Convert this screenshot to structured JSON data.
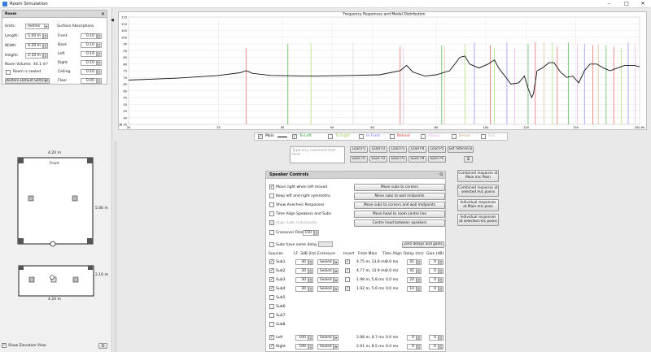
{
  "window": {
    "title": "Room Simulation"
  },
  "room": {
    "header": "Room",
    "units_label": "Units:",
    "units_value": "metres",
    "length_label": "Length:",
    "length_value": "5.00 m",
    "width_label": "Width:",
    "width_value": "4.20 m",
    "height_label": "Height:",
    "height_value": "2.10 m",
    "volume_label": "Room Volume:",
    "volume_value": "44.1 m³",
    "sealed_label": "Room is sealed",
    "restore_label": "Restore Default Settings",
    "surface_header": "Surface Absorptions",
    "surfaces": [
      {
        "label": "Front",
        "value": "0.10"
      },
      {
        "label": "Back",
        "value": "0.10"
      },
      {
        "label": "Left",
        "value": "0.10"
      },
      {
        "label": "Right",
        "value": "0.10"
      },
      {
        "label": "Ceiling",
        "value": "0.10"
      },
      {
        "label": "Floor",
        "value": "0.05"
      }
    ]
  },
  "plan": {
    "top_width": "4.20 m",
    "front_label": "Front",
    "side_length": "5.00 m",
    "elev_width": "4.20 m",
    "elev_height": "2.10 m",
    "show_elevation_label": "Show Elevation View"
  },
  "graph": {
    "title": "Frequency Responses and Modal Distribution",
    "y_ticks": [
      "115",
      "110",
      "105",
      "100",
      "95",
      "90",
      "85",
      "80",
      "75",
      "70",
      "65",
      "60",
      "55",
      "50",
      "45",
      "40",
      "35"
    ],
    "y_bottom": "dB 35",
    "x_ticks": [
      "20",
      "30",
      "40",
      "50",
      "60",
      "80",
      "100",
      "120",
      "150",
      "200 Hz"
    ]
  },
  "legend": {
    "items": [
      {
        "label": "Main",
        "checked": true,
        "color": "#000000"
      },
      {
        "label": "To Left",
        "checked": true,
        "color": "#1a9a1a"
      },
      {
        "label": "To Right",
        "checked": false,
        "color": "#8fd04a"
      },
      {
        "label": "In Front",
        "checked": false,
        "color": "#6a6aff"
      },
      {
        "label": "Behind",
        "checked": false,
        "color": "#e03030"
      },
      {
        "label": "Above",
        "checked": false,
        "color": "#e8a0e8"
      },
      {
        "label": "Below",
        "checked": false,
        "color": "#d0a878"
      },
      {
        "label": "Run",
        "checked": false,
        "color": "#c0c0c0"
      }
    ]
  },
  "comment": {
    "placeholder": "Type any comment text here",
    "load": [
      "Load P1",
      "Load P2",
      "Load P3",
      "Load P4",
      "Load P5"
    ],
    "save": [
      "Save P1",
      "Save P2",
      "Save P3",
      "Save P4",
      "Save P5"
    ],
    "set_reference": "Set reference"
  },
  "speaker": {
    "header": "Speaker Controls",
    "options": [
      {
        "label": "Move right when left moved",
        "checked": true
      },
      {
        "label": "Keep left and right symmetric",
        "checked": false
      },
      {
        "label": "Show Anechoic Responses",
        "checked": false
      },
      {
        "label": "Time Align Speakers and Subs",
        "checked": false
      },
      {
        "label": "Align Subs Individually",
        "checked": false
      }
    ],
    "crossover_label": "Crossover Filter (Hz)",
    "crossover_value": "150",
    "same_delay_label": "Subs have same delay",
    "zero_label": "Zero delays and gains",
    "actions": [
      "Move subs to corners",
      "Move subs to wall midpoints",
      "Move subs to corners and wall midpoints",
      "Move head to room centre line",
      "Centre head between speakers"
    ],
    "columns": [
      "Sources",
      "LF -3dB (Hz)",
      "Enclosure",
      "Invert",
      "From Main",
      "Time Align",
      "Delay (ms)",
      "Gain (dB)"
    ],
    "rows": [
      {
        "name": "Sub1",
        "checked": true,
        "lf": "30",
        "enc": "Sealed",
        "invert": true,
        "from": "4.75 m, 13.8 ms",
        "ta": "0.0 ms",
        "delay": "41",
        "gain": "0"
      },
      {
        "name": "Sub2",
        "checked": true,
        "lf": "30",
        "enc": "Sealed",
        "invert": true,
        "from": "4.77 m, 13.9 ms",
        "ta": "0.0 ms",
        "delay": "41",
        "gain": "0"
      },
      {
        "name": "Sub3",
        "checked": true,
        "lf": "30",
        "enc": "Sealed",
        "invert": false,
        "from": "1.98 m, 5.8 ms",
        "ta": "0.0 ms",
        "delay": "24",
        "gain": "0"
      },
      {
        "name": "Sub4",
        "checked": true,
        "lf": "30",
        "enc": "Sealed",
        "invert": true,
        "from": "1.92 m, 5.6 ms",
        "ta": "0.0 ms",
        "delay": "14",
        "gain": "0"
      },
      {
        "name": "Sub5",
        "checked": false
      },
      {
        "name": "Sub6",
        "checked": false
      },
      {
        "name": "Sub7",
        "checked": false
      },
      {
        "name": "Sub8",
        "checked": false
      },
      {
        "name": "Left",
        "checked": true,
        "lf": "100",
        "enc": "Sealed",
        "invert": false,
        "from": "2.98 m, 8.7 ms",
        "ta": "0.0 ms",
        "delay": "0",
        "gain": "0"
      },
      {
        "name": "Right",
        "checked": true,
        "lf": "100",
        "enc": "Sealed",
        "invert": false,
        "from": "2.91 m, 8.5 ms",
        "ta": "0.0 ms",
        "delay": "0",
        "gain": "0"
      }
    ]
  },
  "combined": [
    "Combined response at Main mic Posn",
    "Combined response at selected mic posns",
    "Individual responses at Main mic posn",
    "Individual responses at selected mic posns"
  ]
}
